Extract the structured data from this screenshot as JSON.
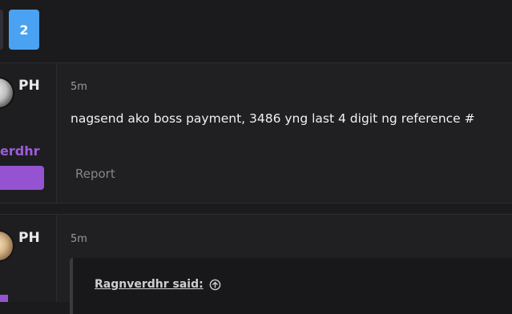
{
  "pagination": {
    "current_page": "2"
  },
  "posts": [
    {
      "country": "PH",
      "username": "erdhr",
      "time": "5m",
      "message": "nagsend ako boss payment, 3486 yng last 4 digit ng reference #",
      "report_label": "Report"
    },
    {
      "country": "PH",
      "time": "5m",
      "quote": {
        "author": "Ragnverdhr said:"
      }
    }
  ],
  "colors": {
    "accent_blue": "#4aa2f2",
    "username_purple": "#9b5dd8",
    "background": "#1b1b1d"
  },
  "icons": [
    "arrow-up-circle-icon"
  ]
}
